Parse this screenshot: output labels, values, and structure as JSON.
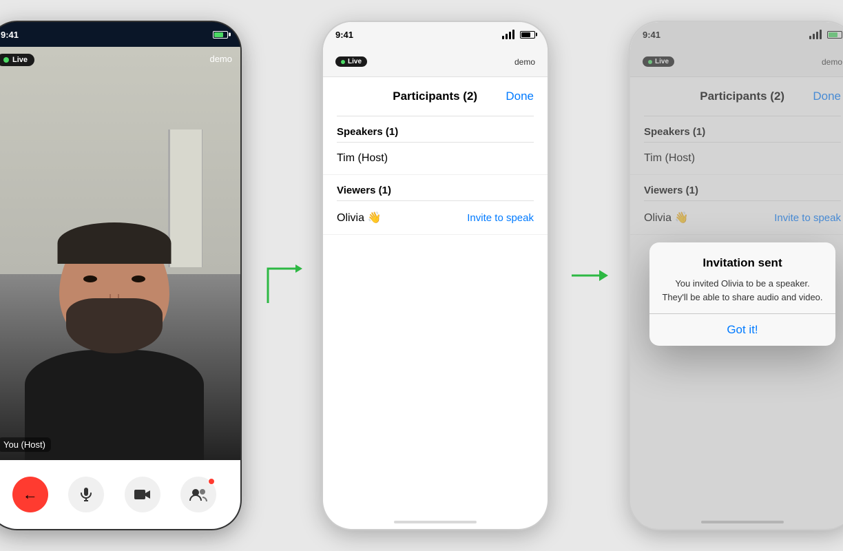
{
  "phone1": {
    "status_time": "9:41",
    "live_label": "Live",
    "demo_label": "demo",
    "you_host_label": "You (Host)",
    "controls": {
      "back_icon": "←",
      "mic_icon": "🎙",
      "video_icon": "📷",
      "participants_icon": "👥"
    }
  },
  "phone2": {
    "status_time": "9:41",
    "live_label": "Live",
    "demo_label": "demo",
    "panel_title": "Participants (2)",
    "done_label": "Done",
    "speakers_section": "Speakers (1)",
    "tim_host": "Tim (Host)",
    "viewers_section": "Viewers (1)",
    "olivia_name": "Olivia 👋",
    "invite_label": "Invite to speak"
  },
  "phone3": {
    "status_time": "9:41",
    "live_label": "Live",
    "demo_label": "demo",
    "panel_title": "Participants (2)",
    "done_label": "Done",
    "speakers_section": "Speakers (1)",
    "tim_host": "Tim (Host)",
    "viewers_section": "Viewers (1)",
    "olivia_name": "Olivia 👋",
    "invite_label": "Invite to speak",
    "modal": {
      "title": "Invitation sent",
      "body": "You invited Olivia to be a speaker. They'll be able to share audio and video.",
      "action": "Got it!"
    }
  }
}
